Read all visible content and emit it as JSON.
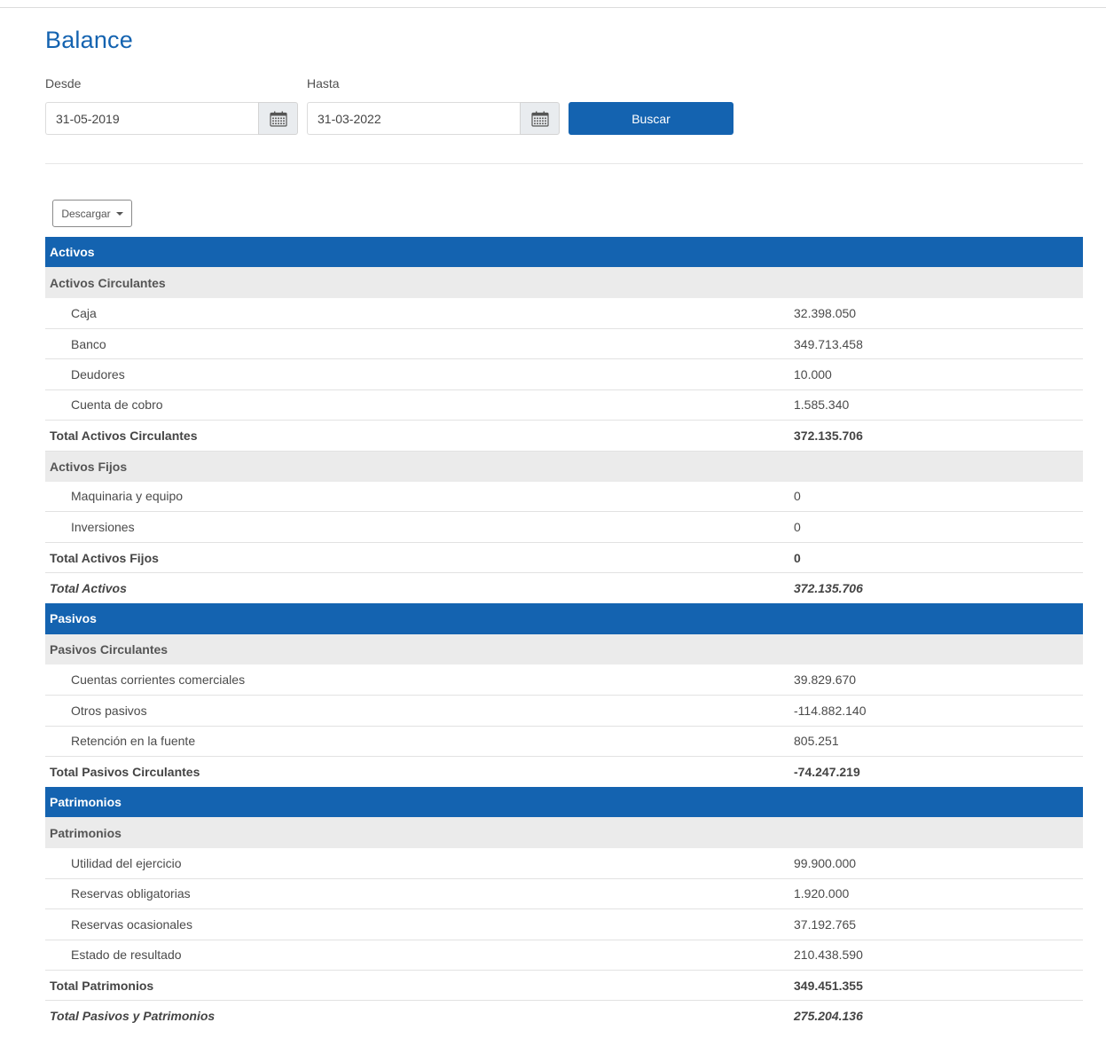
{
  "page": {
    "title": "Balance"
  },
  "filters": {
    "from_label": "Desde",
    "from_value": "31-05-2019",
    "to_label": "Hasta",
    "to_value": "31-03-2022",
    "search_label": "Buscar"
  },
  "download": {
    "label": "Descargar"
  },
  "colors": {
    "accent": "#1463b0",
    "subheader_bg": "#ebebeb"
  },
  "table": {
    "rows": [
      {
        "type": "sec",
        "label": "Activos",
        "value": ""
      },
      {
        "type": "sub",
        "label": "Activos Circulantes",
        "value": ""
      },
      {
        "type": "item",
        "label": "Caja",
        "value": "32.398.050"
      },
      {
        "type": "item",
        "label": "Banco",
        "value": "349.713.458"
      },
      {
        "type": "item",
        "label": "Deudores",
        "value": "10.000"
      },
      {
        "type": "item",
        "label": "Cuenta de cobro",
        "value": "1.585.340"
      },
      {
        "type": "tot",
        "label": "Total Activos Circulantes",
        "value": "372.135.706"
      },
      {
        "type": "sub",
        "label": "Activos Fijos",
        "value": ""
      },
      {
        "type": "item",
        "label": "Maquinaria y equipo",
        "value": "0"
      },
      {
        "type": "item",
        "label": "Inversiones",
        "value": "0"
      },
      {
        "type": "tot",
        "label": "Total Activos Fijos",
        "value": "0"
      },
      {
        "type": "gtot",
        "label": "Total Activos",
        "value": "372.135.706"
      },
      {
        "type": "sec",
        "label": "Pasivos",
        "value": ""
      },
      {
        "type": "sub",
        "label": "Pasivos Circulantes",
        "value": ""
      },
      {
        "type": "item",
        "label": "Cuentas corrientes comerciales",
        "value": "39.829.670"
      },
      {
        "type": "item",
        "label": "Otros pasivos",
        "value": "-114.882.140"
      },
      {
        "type": "item",
        "label": "Retención en la fuente",
        "value": "805.251"
      },
      {
        "type": "tot",
        "label": "Total Pasivos Circulantes",
        "value": "-74.247.219"
      },
      {
        "type": "sec",
        "label": "Patrimonios",
        "value": ""
      },
      {
        "type": "sub",
        "label": "Patrimonios",
        "value": ""
      },
      {
        "type": "item",
        "label": "Utilidad del ejercicio",
        "value": "99.900.000"
      },
      {
        "type": "item",
        "label": "Reservas obligatorias",
        "value": "1.920.000"
      },
      {
        "type": "item",
        "label": "Reservas ocasionales",
        "value": "37.192.765"
      },
      {
        "type": "item",
        "label": "Estado de resultado",
        "value": "210.438.590"
      },
      {
        "type": "tot",
        "label": "Total Patrimonios",
        "value": "349.451.355"
      },
      {
        "type": "gtot",
        "label": "Total Pasivos y Patrimonios",
        "value": "275.204.136"
      }
    ]
  }
}
